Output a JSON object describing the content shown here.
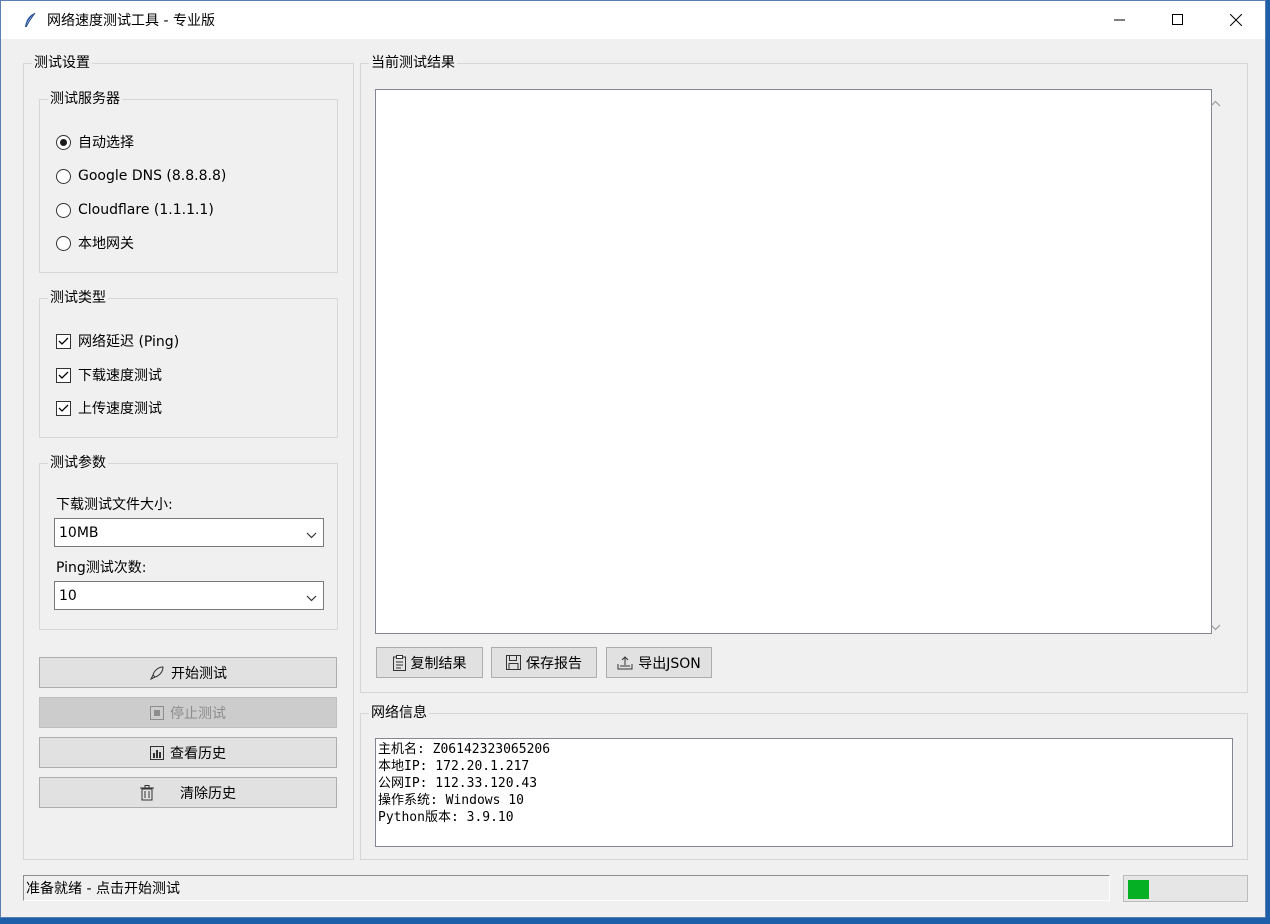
{
  "window": {
    "title": "网络速度测试工具 - 专业版"
  },
  "settings": {
    "group_label": "测试设置",
    "server": {
      "label": "测试服务器",
      "options": [
        "自动选择",
        "Google DNS (8.8.8.8)",
        "Cloudflare (1.1.1.1)",
        "本地网关"
      ],
      "selected": "自动选择"
    },
    "types": {
      "label": "测试类型",
      "items": [
        {
          "label": "网络延迟 (Ping)",
          "checked": true
        },
        {
          "label": "下载速度测试",
          "checked": true
        },
        {
          "label": "上传速度测试",
          "checked": true
        }
      ]
    },
    "params": {
      "label": "测试参数",
      "download_size_label": "下载测试文件大小:",
      "download_size_value": "10MB",
      "ping_count_label": "Ping测试次数:",
      "ping_count_value": "10"
    },
    "buttons": {
      "start": "开始测试",
      "stop": "停止测试",
      "history": "查看历史",
      "clear": "清除历史"
    }
  },
  "results": {
    "group_label": "当前测试结果",
    "text": "",
    "buttons": {
      "copy": "复制结果",
      "save": "保存报告",
      "export": "导出JSON"
    }
  },
  "network": {
    "group_label": "网络信息",
    "lines": [
      "主机名: Z06142323065206",
      "本地IP: 172.20.1.217",
      "公网IP: 112.33.120.43",
      "操作系统: Windows 10",
      "Python版本: 3.9.10"
    ]
  },
  "status": {
    "text": "准备就绪 - 点击开始测试",
    "progress": 0.18,
    "progress_color": "#06b025"
  }
}
